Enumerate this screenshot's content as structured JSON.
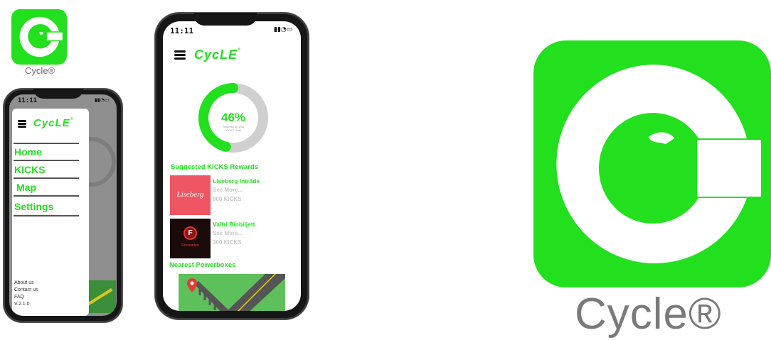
{
  "brand": {
    "name": "Cycle®",
    "color": "#22e01e",
    "caption_color": "#7a7a7a"
  },
  "phone_menu": {
    "status_time": "11:11",
    "wordmark": "CycLE",
    "wordmark_mark": "®",
    "menu_items": [
      "Home",
      "KICKS",
      "Map",
      "Settings"
    ],
    "footer_links": [
      "About us",
      "Contact us",
      "FAQ",
      "V.2.1.0"
    ]
  },
  "phone_home": {
    "status_time": "11:11",
    "wordmark": "CycLE",
    "wordmark_mark": "®",
    "progress": {
      "value_fraction": 0.46,
      "percent_label": "46%",
      "caption": "Progress on your KICKS Goal"
    },
    "rewards_title": "Suggested KICKS Rewards",
    "rewards": [
      {
        "title": "Liseberg Inträde",
        "see_more": "See More...",
        "kicks": "800 KICKS",
        "image_text": "Liseberg",
        "image_bg": "#ef5562"
      },
      {
        "title": "Valfri Biobiljett",
        "see_more": "See More...",
        "kicks": "300 KICKS",
        "image_text": "Filmstaden",
        "image_bg": "#1a0a0a"
      }
    ],
    "powerboxes_title": "Nearest Powerboxes"
  }
}
